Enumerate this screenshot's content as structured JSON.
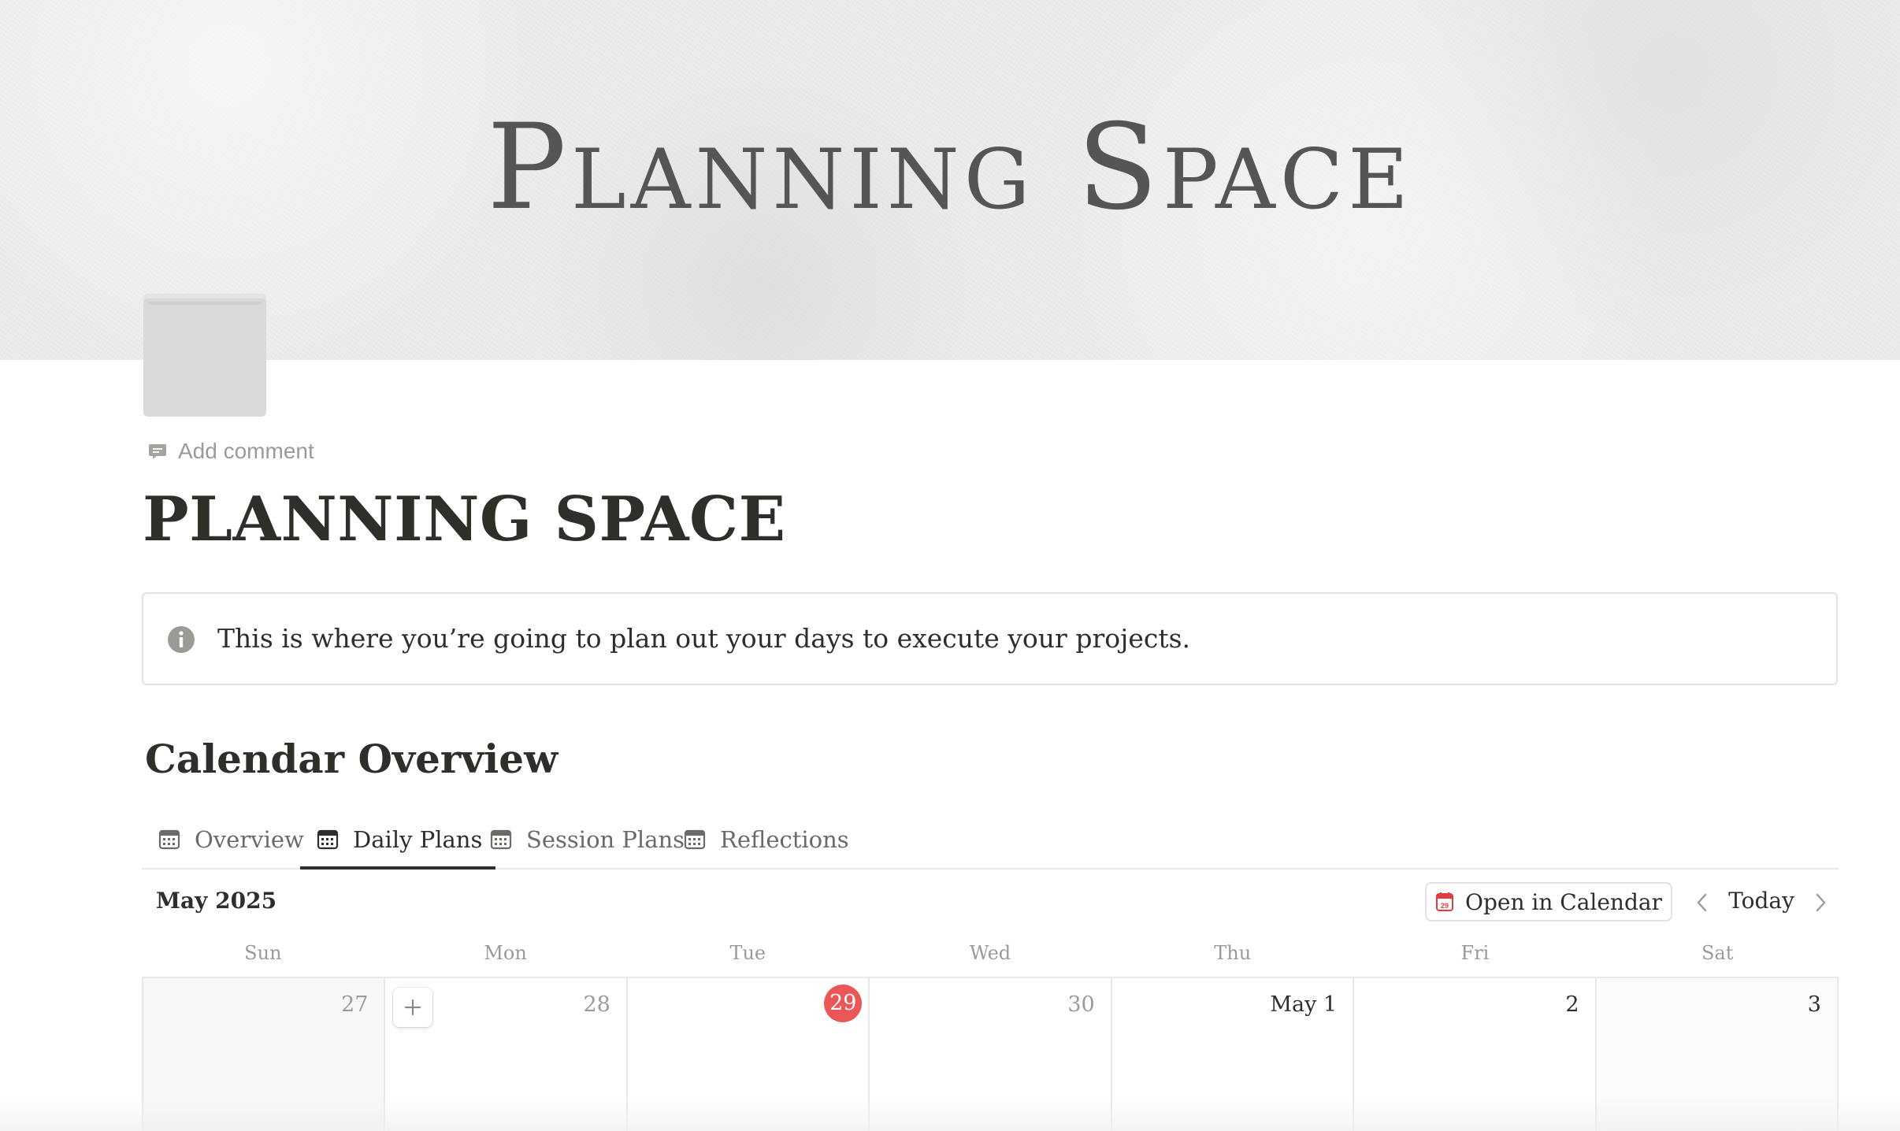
{
  "cover": {
    "title": "Planning Space"
  },
  "page": {
    "add_comment_label": "Add comment",
    "title": "PLANNING SPACE"
  },
  "callout": {
    "text": "This is where you’re going to plan out your days to execute your projects.",
    "icon": "info-icon"
  },
  "section": {
    "heading": "Calendar Overview"
  },
  "tabs": [
    {
      "label": "Overview",
      "icon": "calendar-icon",
      "active": false
    },
    {
      "label": "Daily Plans",
      "icon": "calendar-icon",
      "active": true
    },
    {
      "label": "Session Plans",
      "icon": "calendar-icon",
      "active": false
    },
    {
      "label": "Reflections",
      "icon": "calendar-icon",
      "active": false
    }
  ],
  "calendar": {
    "month_label": "May 2025",
    "open_button_label": "Open in Calendar",
    "today_label": "Today",
    "weekdays": [
      "Sun",
      "Mon",
      "Tue",
      "Wed",
      "Thu",
      "Fri",
      "Sat"
    ],
    "days": [
      "27",
      "28",
      "29",
      "30",
      "May 1",
      "2",
      "3"
    ],
    "today_day": "29",
    "today_color": "#eb5757"
  }
}
